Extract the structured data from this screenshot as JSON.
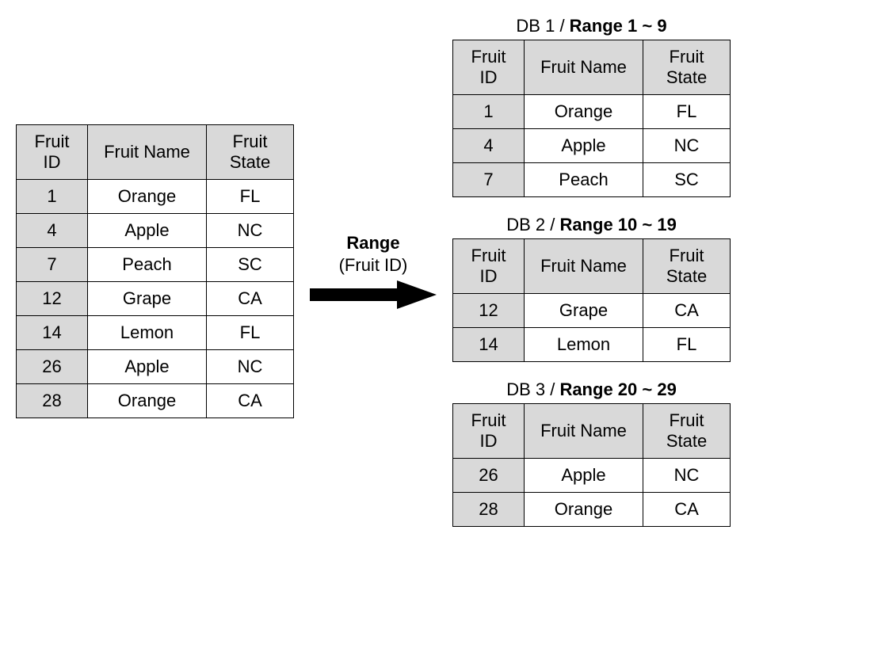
{
  "columns": {
    "id": "Fruit ID",
    "name": "Fruit Name",
    "state": "Fruit State"
  },
  "source_rows": [
    {
      "id": "1",
      "name": "Orange",
      "state": "FL"
    },
    {
      "id": "4",
      "name": "Apple",
      "state": "NC"
    },
    {
      "id": "7",
      "name": "Peach",
      "state": "SC"
    },
    {
      "id": "12",
      "name": "Grape",
      "state": "CA"
    },
    {
      "id": "14",
      "name": "Lemon",
      "state": "FL"
    },
    {
      "id": "26",
      "name": "Apple",
      "state": "NC"
    },
    {
      "id": "28",
      "name": "Orange",
      "state": "CA"
    }
  ],
  "arrow": {
    "label_bold": "Range",
    "label_sub": "(Fruit ID)"
  },
  "partitions": [
    {
      "caption_prefix": "DB 1 / ",
      "caption_bold": "Range 1 ~ 9",
      "rows": [
        {
          "id": "1",
          "name": "Orange",
          "state": "FL"
        },
        {
          "id": "4",
          "name": "Apple",
          "state": "NC"
        },
        {
          "id": "7",
          "name": "Peach",
          "state": "SC"
        }
      ]
    },
    {
      "caption_prefix": "DB 2 / ",
      "caption_bold": "Range 10 ~ 19",
      "rows": [
        {
          "id": "12",
          "name": "Grape",
          "state": "CA"
        },
        {
          "id": "14",
          "name": "Lemon",
          "state": "FL"
        }
      ]
    },
    {
      "caption_prefix": "DB 3 / ",
      "caption_bold": "Range 20 ~ 29",
      "rows": [
        {
          "id": "26",
          "name": "Apple",
          "state": "NC"
        },
        {
          "id": "28",
          "name": "Orange",
          "state": "CA"
        }
      ]
    }
  ]
}
